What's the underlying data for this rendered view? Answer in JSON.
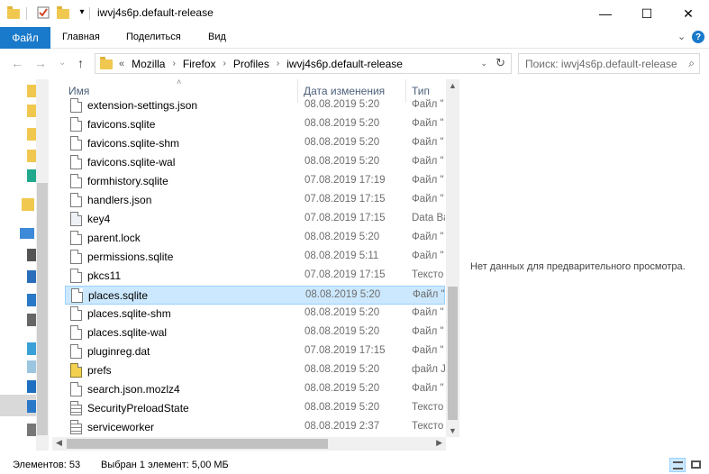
{
  "window": {
    "title": "iwvj4s6p.default-release",
    "minimize_glyph": "—",
    "maximize_glyph": "☐",
    "close_glyph": "✕"
  },
  "ribbon": {
    "file_tab": "Файл",
    "tabs": [
      "Главная",
      "Поделиться",
      "Вид"
    ],
    "expand_glyph": "⌄",
    "help_glyph": "?"
  },
  "nav": {
    "back_glyph": "←",
    "forward_glyph": "→",
    "recent_glyph": "⌄",
    "up_glyph": "↑",
    "overflow": "«",
    "breadcrumbs": [
      "Mozilla",
      "Firefox",
      "Profiles",
      "iwvj4s6p.default-release"
    ],
    "separator": "›",
    "dropdown_glyph": "⌄",
    "refresh_glyph": "↻"
  },
  "search": {
    "placeholder": "Поиск: iwvj4s6p.default-release",
    "icon_glyph": "⌕"
  },
  "columns": {
    "name": "Имя",
    "date": "Дата изменения",
    "type": "Тип",
    "sort_glyph": "˄"
  },
  "files": [
    {
      "name": "extension-settings.json",
      "date": "08.08.2019 5:20",
      "type": "Файл \"",
      "icon": "file-icon",
      "selected": false
    },
    {
      "name": "favicons.sqlite",
      "date": "08.08.2019 5:20",
      "type": "Файл \"",
      "icon": "file-icon",
      "selected": false
    },
    {
      "name": "favicons.sqlite-shm",
      "date": "08.08.2019 5:20",
      "type": "Файл \"",
      "icon": "file-icon",
      "selected": false
    },
    {
      "name": "favicons.sqlite-wal",
      "date": "08.08.2019 5:20",
      "type": "Файл \"",
      "icon": "file-icon",
      "selected": false
    },
    {
      "name": "formhistory.sqlite",
      "date": "07.08.2019 17:19",
      "type": "Файл \"",
      "icon": "file-icon",
      "selected": false
    },
    {
      "name": "handlers.json",
      "date": "07.08.2019 17:15",
      "type": "Файл \"",
      "icon": "file-icon",
      "selected": false
    },
    {
      "name": "key4",
      "date": "07.08.2019 17:15",
      "type": "Data Ba",
      "icon": "database-file-icon",
      "selected": false
    },
    {
      "name": "parent.lock",
      "date": "08.08.2019 5:20",
      "type": "Файл \"",
      "icon": "file-icon",
      "selected": false
    },
    {
      "name": "permissions.sqlite",
      "date": "08.08.2019 5:11",
      "type": "Файл \"",
      "icon": "file-icon",
      "selected": false
    },
    {
      "name": "pkcs11",
      "date": "07.08.2019 17:15",
      "type": "Тексто",
      "icon": "file-icon",
      "selected": false
    },
    {
      "name": "places.sqlite",
      "date": "08.08.2019 5:20",
      "type": "Файл \"",
      "icon": "file-icon",
      "selected": true
    },
    {
      "name": "places.sqlite-shm",
      "date": "08.08.2019 5:20",
      "type": "Файл \"",
      "icon": "file-icon",
      "selected": false
    },
    {
      "name": "places.sqlite-wal",
      "date": "08.08.2019 5:20",
      "type": "Файл \"",
      "icon": "file-icon",
      "selected": false
    },
    {
      "name": "pluginreg.dat",
      "date": "07.08.2019 17:15",
      "type": "Файл \"",
      "icon": "file-icon",
      "selected": false
    },
    {
      "name": "prefs",
      "date": "08.08.2019 5:20",
      "type": "файл J",
      "icon": "js-file-icon",
      "selected": false
    },
    {
      "name": "search.json.mozlz4",
      "date": "08.08.2019 5:20",
      "type": "Файл \"",
      "icon": "file-icon",
      "selected": false
    },
    {
      "name": "SecurityPreloadState",
      "date": "08.08.2019 5:20",
      "type": "Тексто",
      "icon": "text-file-icon",
      "selected": false
    },
    {
      "name": "serviceworker",
      "date": "08.08.2019 2:37",
      "type": "Тексто",
      "icon": "text-file-icon",
      "selected": false
    }
  ],
  "preview": {
    "message": "Нет данных для предварительного просмотра."
  },
  "status": {
    "items_count": "Элементов: 53",
    "selection": "Выбран 1 элемент: 5,00 МБ"
  },
  "colors": {
    "accent": "#1979ca",
    "selection_bg": "#cce8ff",
    "selection_border": "#99d1ff",
    "header_text": "#4c607a"
  }
}
